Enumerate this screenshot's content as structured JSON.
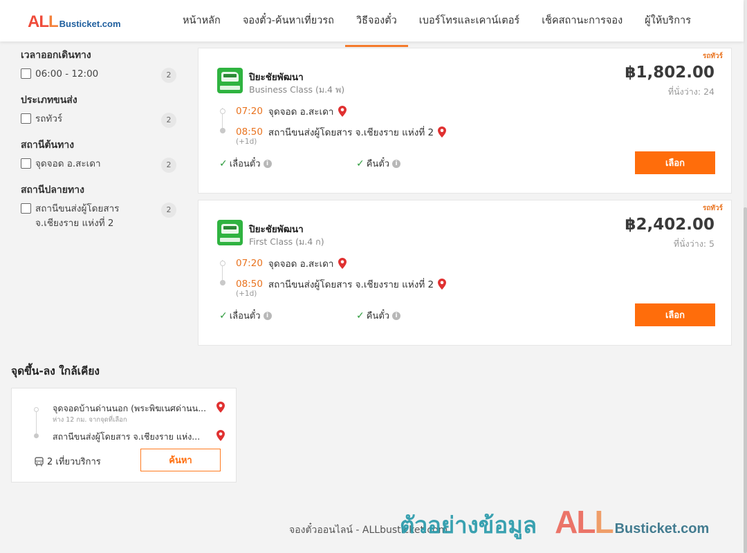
{
  "header": {
    "logo_all_1": "AL",
    "logo_all_2": "L",
    "logo_site": "Busticket.com",
    "nav": [
      {
        "label": "หน้าหลัก"
      },
      {
        "label": "จองตั๋ว-ค้นหาเที่ยวรถ"
      },
      {
        "label": "วิธีจองตั๋ว"
      },
      {
        "label": "เบอร์โทรและเคาน์เตอร์"
      },
      {
        "label": "เช็คสถานะการจอง"
      },
      {
        "label": "ผู้ให้บริการ"
      }
    ]
  },
  "filters": [
    {
      "title": "เวลาออกเดินทาง",
      "option": "06:00 - 12:00",
      "count": "2"
    },
    {
      "title": "ประเภทขนส่ง",
      "option": "รถทัวร์",
      "count": "2"
    },
    {
      "title": "สถานีต้นทาง",
      "option": "จุดจอด อ.สะเดา",
      "count": "2"
    },
    {
      "title": "สถานีปลายทาง",
      "option": "สถานีขนส่งผู้โดยสาร จ.เชียงราย แห่งที่ 2",
      "count": "2"
    }
  ],
  "trips": [
    {
      "tag": "รถทัวร์",
      "operator": "ปิยะชัยพัฒนา",
      "class": "Business Class (ม.4 พ)",
      "price": "฿1,802.00",
      "seats": "ที่นั่งว่าง: 24",
      "depart_time": "07:20",
      "depart_stop": "จุดจอด อ.สะเดา",
      "arrive_time": "08:50",
      "arrive_stop": "สถานีขนส่งผู้โดยสาร จ.เชียงราย แห่งที่ 2",
      "day_offset": "(+1d)",
      "feature1": "เลื่อนตั๋ว",
      "feature2": "คืนตั๋ว",
      "select_label": "เลือก"
    },
    {
      "tag": "รถทัวร์",
      "operator": "ปิยะชัยพัฒนา",
      "class": "First Class (ม.4 ก)",
      "price": "฿2,402.00",
      "seats": "ที่นั่งว่าง: 5",
      "depart_time": "07:20",
      "depart_stop": "จุดจอด อ.สะเดา",
      "arrive_time": "08:50",
      "arrive_stop": "สถานีขนส่งผู้โดยสาร จ.เชียงราย แห่งที่ 2",
      "day_offset": "(+1d)",
      "feature1": "เลื่อนตั๋ว",
      "feature2": "คืนตั๋ว",
      "select_label": "เลือก"
    }
  ],
  "nearby": {
    "title": "จุดขึ้น-ลง ใกล้เคียง",
    "stop1": "จุดจอดบ้านด่านนอก (พระพิฆเนศด่านน...",
    "stop1_sub": "ห่าง 12 กม. จากจุดที่เลือก",
    "stop2": "สถานีขนส่งผู้โดยสาร จ.เชียงราย แห่ง...",
    "trips": "2 เที่ยวบริการ",
    "search_label": "ค้นหา"
  },
  "footer": {
    "text": "จองตั๋วออนไลน์ - ALLbusticket.com",
    "watermark_text": "ตัวอย่างข้อมูล",
    "watermark_all_1": "AL",
    "watermark_all_2": "L",
    "watermark_site": "Busticket.com"
  },
  "colors": {
    "accent": "#ff6d0b",
    "time": "#e9731f",
    "check": "#2d9b3c",
    "pin": "#e03131"
  },
  "icons": {
    "pin": "map-pin-icon",
    "check": "check-icon",
    "info": "info-icon",
    "bus": "bus-icon"
  }
}
